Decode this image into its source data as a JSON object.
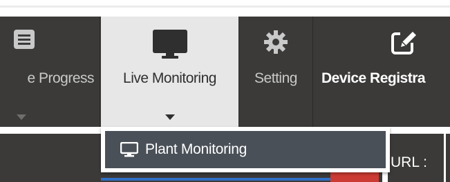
{
  "nav": {
    "items": [
      {
        "label": "e Progress",
        "icon": "list-icon",
        "has_caret": true,
        "active": false
      },
      {
        "label": "Live Monitoring",
        "icon": "monitor-icon",
        "has_caret": true,
        "active": true
      },
      {
        "label": "Setting",
        "icon": "gear-icon",
        "has_caret": false,
        "active": false
      },
      {
        "label": "Device Registra",
        "icon": "edit-icon",
        "has_caret": false,
        "active": false
      }
    ]
  },
  "dropdown": {
    "items": [
      {
        "label": "Plant Monitoring",
        "icon": "monitor-icon"
      }
    ]
  },
  "form": {
    "url_label": "URL :"
  },
  "colors": {
    "navbar_bg": "#3b3a39",
    "active_tab_bg": "#e7e7e7",
    "dropdown_item_bg": "#4a5058",
    "accent_blue": "#2f6fc6",
    "accent_red": "#cc3b33"
  }
}
